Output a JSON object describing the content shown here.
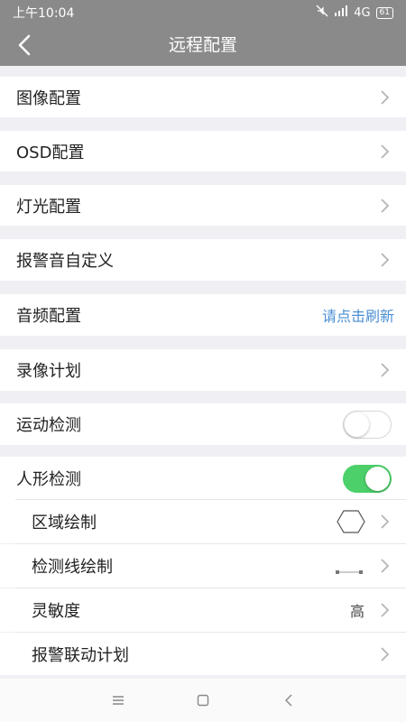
{
  "status_bar": {
    "time": "上午10:04",
    "network": "4G",
    "battery": "61"
  },
  "header": {
    "title": "远程配置"
  },
  "items": {
    "image_config": "图像配置",
    "osd_config": "OSD配置",
    "light_config": "灯光配置",
    "alarm_sound": "报警音自定义",
    "audio_config": "音频配置",
    "audio_refresh": "请点击刷新",
    "record_plan": "录像计划",
    "motion_detect": "运动检测",
    "human_detect": "人形检测",
    "area_draw": "区域绘制",
    "line_draw": "检测线绘制",
    "sensitivity": "灵敏度",
    "sensitivity_value": "高",
    "alarm_link_plan": "报警联动计划"
  },
  "toggles": {
    "motion_detect": false,
    "human_detect": true
  },
  "colors": {
    "header_bg": "#8a8a8a",
    "link": "#4a8fd4",
    "toggle_on": "#4cd06a"
  }
}
